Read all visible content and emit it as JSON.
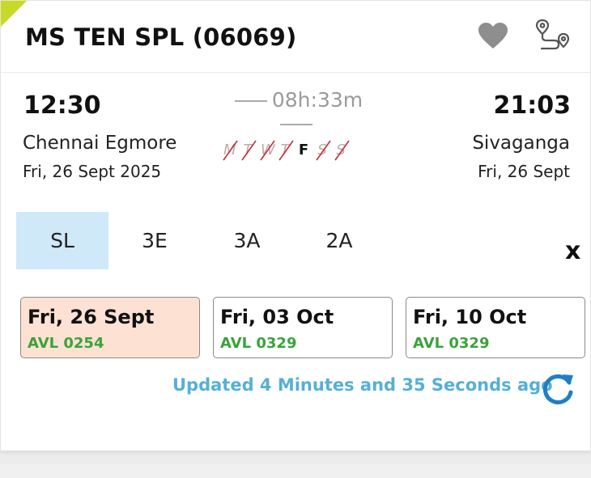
{
  "train": {
    "name": "MS TEN SPL (06069)"
  },
  "journey": {
    "departure_time": "12:30",
    "arrival_time": "21:03",
    "duration": "08h:33m",
    "from_station": "Chennai Egmore",
    "to_station": "Sivaganga",
    "from_date": "Fri, 26 Sept  2025",
    "to_date": "Fri, 26 Sept"
  },
  "running_days": [
    {
      "label": "M",
      "runs": false
    },
    {
      "label": "T",
      "runs": false
    },
    {
      "label": "W",
      "runs": false
    },
    {
      "label": "T",
      "runs": false
    },
    {
      "label": "F",
      "runs": true
    },
    {
      "label": "S",
      "runs": false
    },
    {
      "label": "S",
      "runs": false
    }
  ],
  "classes": {
    "items": [
      "SL",
      "3E",
      "3A",
      "2A"
    ],
    "selected": "SL",
    "close_label": "x"
  },
  "availability": [
    {
      "date": "Fri, 26 Sept",
      "status": "AVL 0254",
      "selected": true
    },
    {
      "date": "Fri, 03 Oct",
      "status": "AVL 0329",
      "selected": false
    },
    {
      "date": "Fri, 10 Oct",
      "status": "AVL 0329",
      "selected": false
    }
  ],
  "updated_text": "Updated 4 Minutes and 35 Seconds ago",
  "icons": {
    "favorite": "heart-icon",
    "route": "route-map-icon",
    "refresh": "refresh-icon"
  },
  "colors": {
    "accent_corner": "#c9d92a",
    "selected_class_bg": "#cfe9f8",
    "selected_date_bg": "#fde2d3",
    "available_green": "#3aa33a",
    "updated_blue": "#55b0d6",
    "refresh_blue": "#1f7fc4"
  }
}
